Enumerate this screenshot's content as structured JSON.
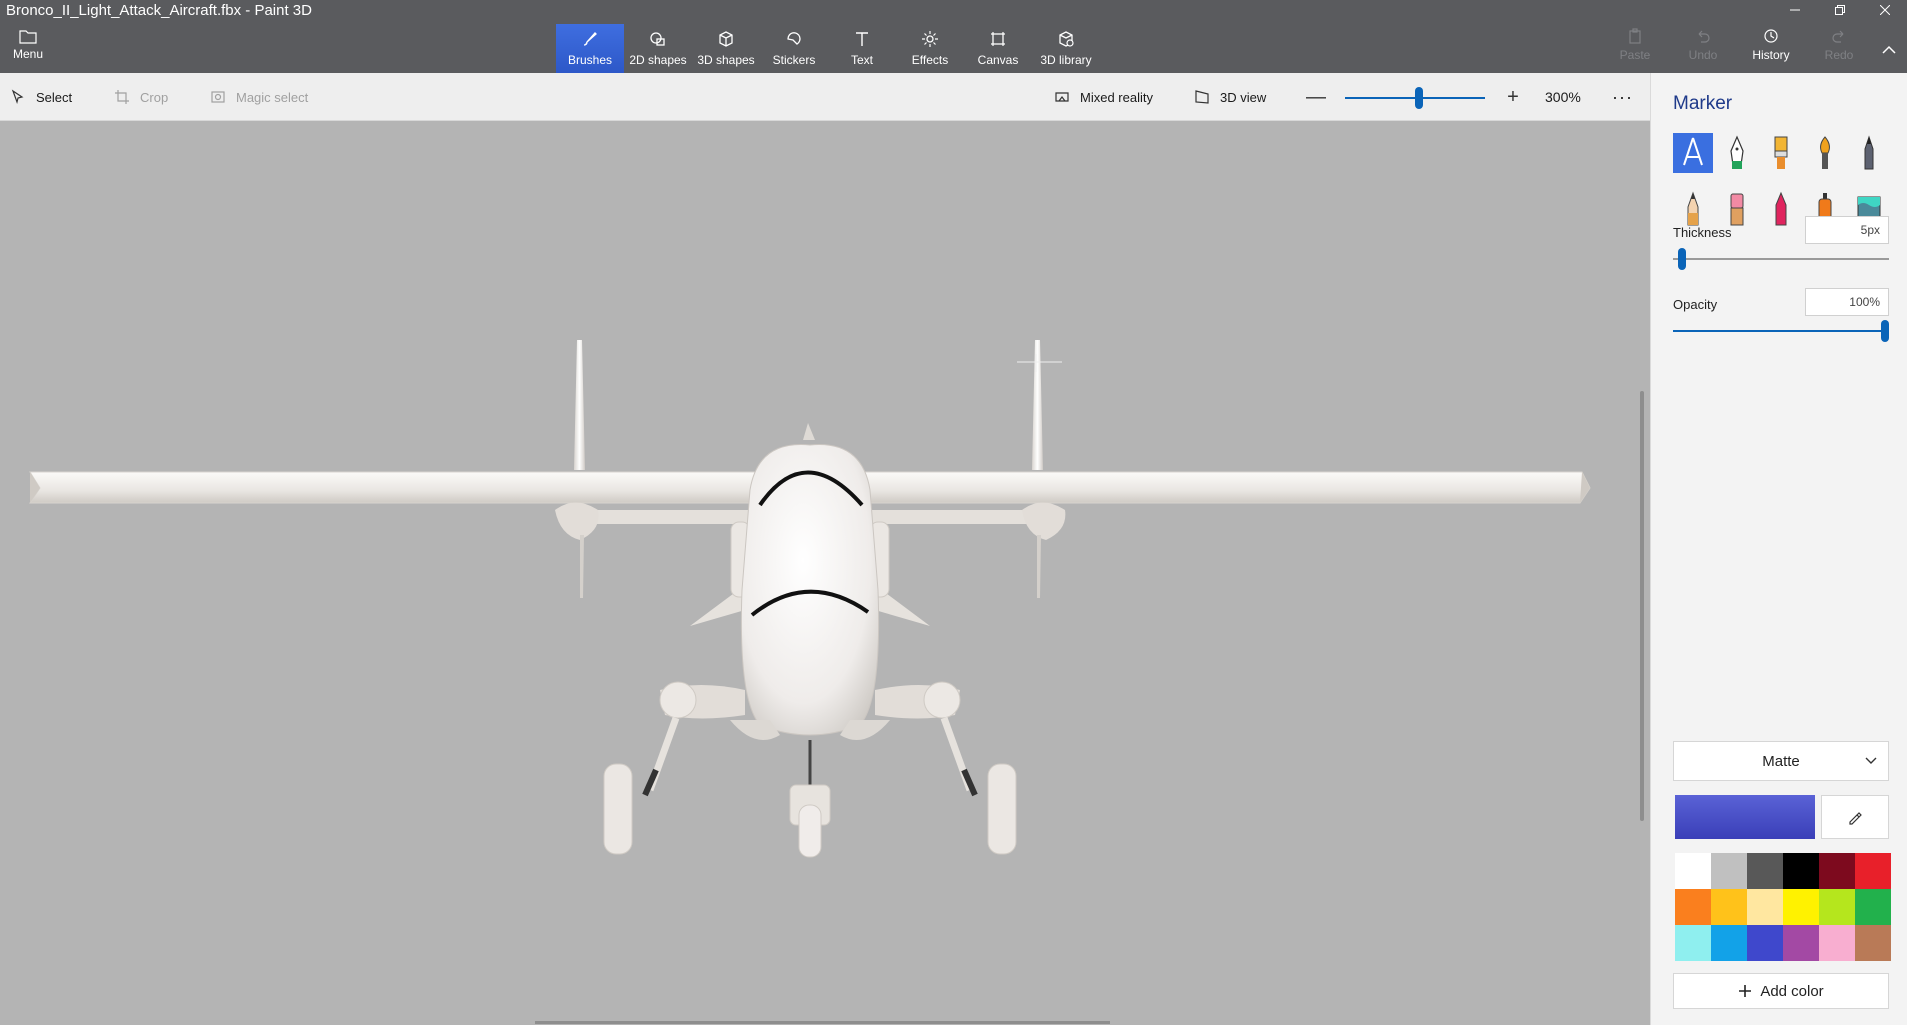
{
  "window": {
    "title": "Bronco_II_Light_Attack_Aircraft.fbx - Paint 3D"
  },
  "menu": {
    "label": "Menu"
  },
  "ribbon": {
    "tools": [
      {
        "label": "Brushes",
        "icon": "brush-icon",
        "active": true
      },
      {
        "label": "2D shapes",
        "icon": "2d-shapes-icon"
      },
      {
        "label": "3D shapes",
        "icon": "3d-shapes-icon"
      },
      {
        "label": "Stickers",
        "icon": "stickers-icon"
      },
      {
        "label": "Text",
        "icon": "text-icon"
      },
      {
        "label": "Effects",
        "icon": "effects-icon"
      },
      {
        "label": "Canvas",
        "icon": "canvas-icon"
      },
      {
        "label": "3D library",
        "icon": "3d-library-icon"
      }
    ],
    "right": [
      {
        "label": "Paste",
        "enabled": false
      },
      {
        "label": "Undo",
        "enabled": false
      },
      {
        "label": "History",
        "enabled": true
      },
      {
        "label": "Redo",
        "enabled": false
      }
    ]
  },
  "commandbar": {
    "select": "Select",
    "crop": "Crop",
    "magic_select": "Magic select",
    "mixed_reality": "Mixed reality",
    "view_3d": "3D view",
    "zoom_minus": "—",
    "zoom_plus": "+",
    "zoom": "300%",
    "more": "···"
  },
  "panel": {
    "title": "Marker",
    "brushes": [
      "marker",
      "calligraphy-pen",
      "oil-brush",
      "watercolor",
      "pixel-pen",
      "pencil",
      "eraser",
      "crayon",
      "spray-can",
      "fill"
    ],
    "thickness_label": "Thickness",
    "thickness_value": "5px",
    "thickness_level": 0.04,
    "opacity_label": "Opacity",
    "opacity_value": "100%",
    "opacity_level": 1.0,
    "finish": "Matte",
    "current_color": "#3a3fb8",
    "palette": [
      "#ffffff",
      "#c0c0c0",
      "#585858",
      "#000000",
      "#7d0a1e",
      "#e8202a",
      "#fa7f1e",
      "#ffc21a",
      "#ffe7a0",
      "#fff200",
      "#b5e61d",
      "#22b14c",
      "#8fefef",
      "#12a2e8",
      "#3f48cc",
      "#a349a4",
      "#f8aed0",
      "#b97a57"
    ],
    "add_color": "Add color"
  }
}
